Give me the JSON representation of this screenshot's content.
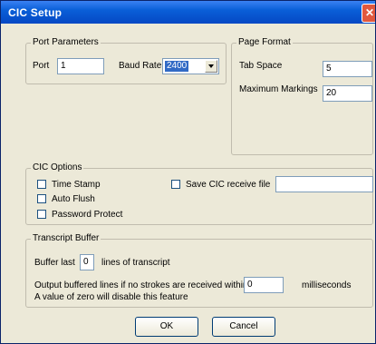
{
  "window": {
    "title": "CIC Setup",
    "close_icon": "close-icon"
  },
  "port_parameters": {
    "legend": "Port Parameters",
    "port_label": "Port",
    "port_value": "1",
    "baud_label": "Baud Rate",
    "baud_value": "2400"
  },
  "page_format": {
    "legend": "Page Format",
    "tab_space_label": "Tab Space",
    "tab_space_value": "5",
    "max_markings_label": "Maximum Markings",
    "max_markings_value": "20"
  },
  "cic_options": {
    "legend": "CIC Options",
    "time_stamp": "Time Stamp",
    "auto_flush": "Auto Flush",
    "password_protect": "Password Protect",
    "save_receive_file": "Save CIC receive file",
    "receive_file_value": ""
  },
  "transcript_buffer": {
    "legend": "Transcript Buffer",
    "buffer_last": "Buffer last",
    "buffer_value": "0",
    "lines_label": "lines of transcript",
    "output_label": "Output buffered lines if no strokes are received within",
    "ms_value": "0",
    "ms_label": "milliseconds",
    "hint": "A value of zero will disable this feature"
  },
  "buttons": {
    "ok": "OK",
    "cancel": "Cancel"
  }
}
